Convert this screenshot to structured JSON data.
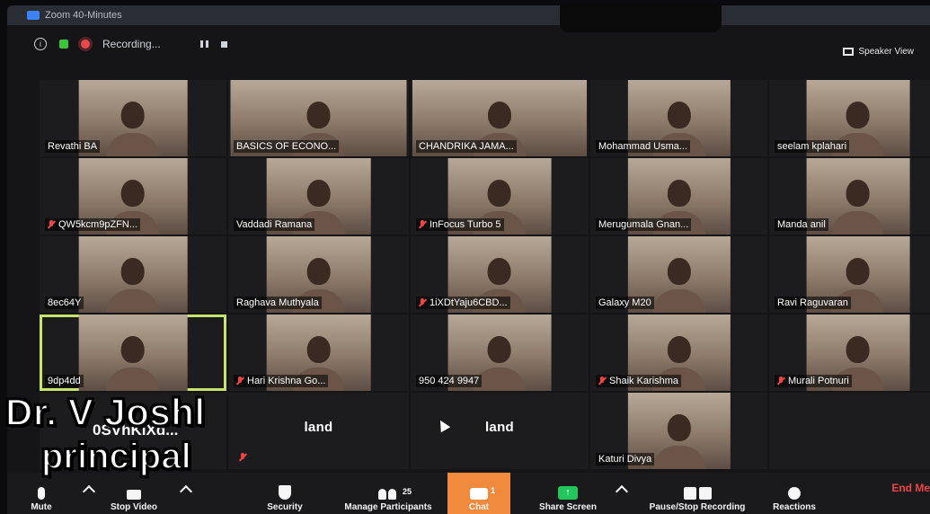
{
  "window": {
    "title": "Zoom 40-Minutes"
  },
  "status": {
    "recording_label": "Recording..."
  },
  "view": {
    "speaker_view_label": "Speaker View"
  },
  "participants": [
    {
      "name": "Revathi BA",
      "muted": false
    },
    {
      "name": "BASICS OF ECONO...",
      "muted": false,
      "wide": true
    },
    {
      "name": "CHANDRIKA JAMA...",
      "muted": false,
      "wide": true
    },
    {
      "name": "Mohammad Usma...",
      "muted": false
    },
    {
      "name": "seelam kplahari",
      "muted": false
    },
    {
      "name": "QW5kcm9pZFN...",
      "muted": true
    },
    {
      "name": "Vaddadi Ramana",
      "muted": false
    },
    {
      "name": "InFocus Turbo 5",
      "muted": true
    },
    {
      "name": "Merugumala Gnan...",
      "muted": false
    },
    {
      "name": "Manda anil",
      "muted": false
    },
    {
      "name": "8ec64Y",
      "muted": false
    },
    {
      "name": "Raghava Muthyala",
      "muted": false
    },
    {
      "name": "1iXDtYaju6CBD...",
      "muted": true
    },
    {
      "name": "Galaxy M20",
      "muted": false
    },
    {
      "name": "Ravi Raguvaran",
      "muted": false
    },
    {
      "name": "9dp4dd",
      "muted": false,
      "active": true
    },
    {
      "name": "Hari Krishna Go...",
      "muted": true
    },
    {
      "name": "950 424 9947",
      "muted": false
    },
    {
      "name": "Shaik Karishma",
      "muted": true
    },
    {
      "name": "Murali Potnuri",
      "muted": true
    },
    {
      "name": "0SVhKlXd...",
      "muted": false,
      "no_video": true
    },
    {
      "name": "land",
      "muted": true,
      "no_video": true,
      "centered": true
    },
    {
      "name": "land",
      "muted": false,
      "no_video": true,
      "centered": true,
      "cursor": true
    },
    {
      "name": "Katuri Divya",
      "muted": false
    },
    {
      "name": "",
      "empty": true
    }
  ],
  "overlay": {
    "line1": "Dr. V Joshl",
    "line2": "principal"
  },
  "toolbar": {
    "mute_label": "Mute",
    "stop_video_label": "Stop Video",
    "security_label": "Security",
    "manage_participants_label": "Manage Participants",
    "participant_count": "25",
    "chat_label": "Chat",
    "chat_badge": "1",
    "share_screen_label": "Share Screen",
    "pause_recording_label": "Pause/Stop Recording",
    "reactions_label": "Reactions",
    "end_label": "End Me"
  },
  "colors": {
    "chat_accent": "#f08a3c",
    "active_speaker_border": "#c8e36a",
    "share_green": "#22c55e",
    "end_red": "#ef4444"
  }
}
